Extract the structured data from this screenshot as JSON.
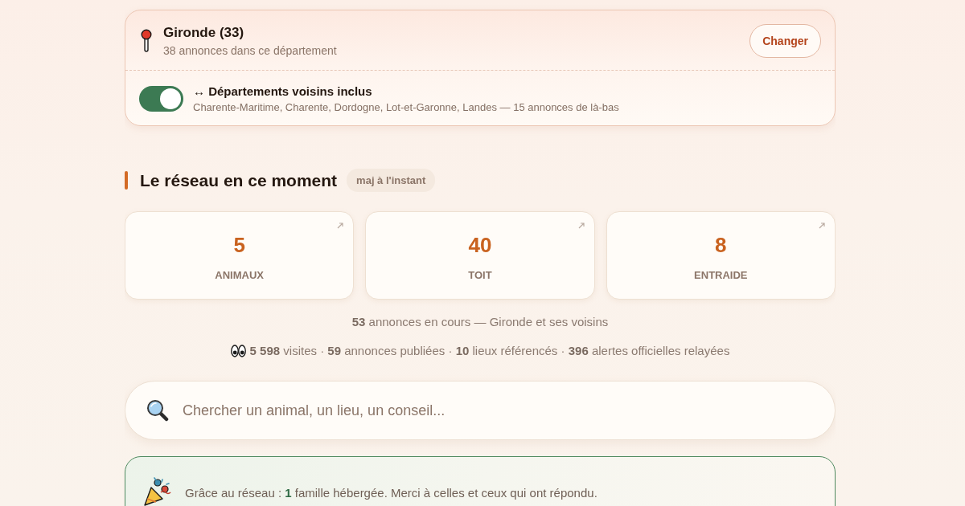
{
  "location": {
    "title": "Gironde (33)",
    "subtitle": "38 annonces dans ce département",
    "button": "Changer"
  },
  "neighbors": {
    "on": true,
    "title": "↔ Départements voisins inclus",
    "description": "Charente-Maritime, Charente, Dordogne, Lot-et-Garonne, Landes — 15 annonces de là-bas"
  },
  "network": {
    "title": "Le réseau en ce moment",
    "badge": "maj à l'instant",
    "stats": [
      {
        "value": "5",
        "label": "ANIMAUX"
      },
      {
        "value": "40",
        "label": "TOIT"
      },
      {
        "value": "8",
        "label": "ENTRAIDE"
      }
    ],
    "summary": "**53** annonces en cours — Gironde et ses voisins",
    "totals": "**5 598** visites · **59** annonces publiées · **10** lieux référencés · **396** alertes officielles relayées"
  },
  "search": {
    "placeholder": "Chercher un animal, un lieu, un conseil..."
  },
  "thanks": {
    "text": "Grâce au réseau : **1** famille hébergée. Merci à celles et ceux qui ont répondu."
  }
}
